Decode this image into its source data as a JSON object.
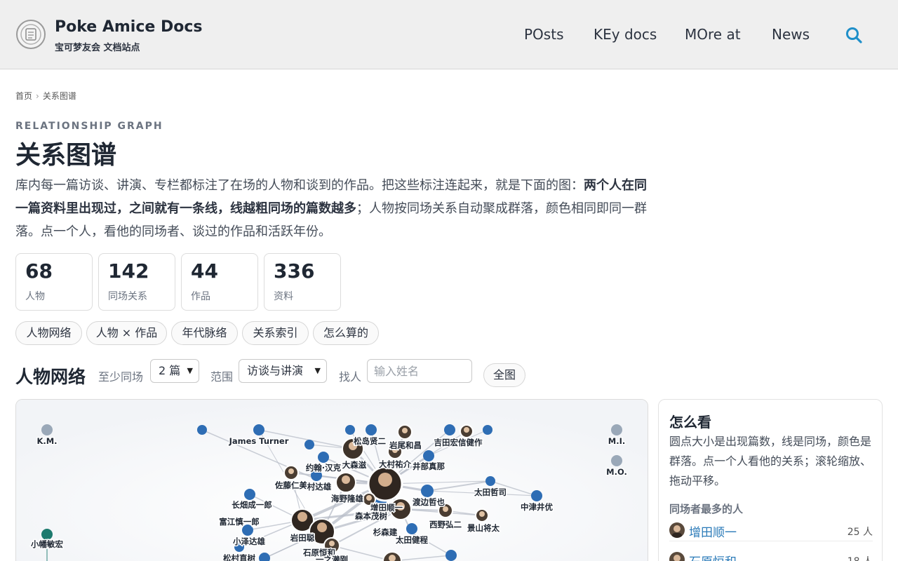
{
  "header": {
    "brand_title": "Poke Amice Docs",
    "brand_subtitle": "宝可梦友会 文档站点",
    "nav": [
      "POsts",
      "KEy docs",
      "MOre at",
      "News"
    ],
    "search_icon": "search-icon",
    "accent_color": "#1f8fc9"
  },
  "breadcrumb": {
    "home": "首页",
    "current": "关系图谱"
  },
  "page": {
    "eyebrow": "RELATIONSHIP GRAPH",
    "title": "关系图谱",
    "intro_1": "库内每一篇访谈、讲演、专栏都标注了在场的人物和谈到的作品。把这些标注连起来，就是下面的图：",
    "intro_bold": "两个人在同一篇资料里出现过，之间就有一条线，线越粗同场的篇数越多",
    "intro_2": "；人物按同场关系自动聚成群落，颜色相同即同一群落。点一个人，看他的同场者、谈过的作品和活跃年份。"
  },
  "stats": [
    {
      "value": "68",
      "label": "人物"
    },
    {
      "value": "142",
      "label": "同场关系"
    },
    {
      "value": "44",
      "label": "作品"
    },
    {
      "value": "336",
      "label": "资料"
    }
  ],
  "tabs": [
    "人物网络",
    "人物 × 作品",
    "年代脉络",
    "关系索引",
    "怎么算的"
  ],
  "controls": {
    "section_title": "人物网络",
    "min_label": "至少同场",
    "min_value": "2 篇",
    "range_label": "范围",
    "range_value": "访谈与讲演",
    "find_label": "找人",
    "find_placeholder": "输入姓名",
    "full_button": "全图"
  },
  "graph": {
    "node_color": "#2e6db4",
    "isolated_color": "#9aa8b8",
    "teal_color": "#1d7a6e",
    "labels": [
      "K.M.",
      "James Turner",
      "松岛贤二",
      "岩尾和昌",
      "吉田宏信健作",
      "M.I.",
      "M.O.",
      "大森滋",
      "大村祐介",
      "井部真那",
      "约翰·汉克",
      "佐藤仁美",
      "村达雄",
      "海野隆雄",
      "太田哲司",
      "中津井优",
      "长畑成一郎",
      "增田顺一",
      "渡边哲也",
      "森本茂树",
      "富江慎一郎",
      "西野弘二",
      "景山将太",
      "杉森建",
      "岩田聪",
      "小泽达雄",
      "太田健程",
      "小幡敏宏",
      "石原恒和",
      "松村直树",
      "一之濑刚"
    ]
  },
  "side": {
    "title": "怎么看",
    "description": "圆点大小是出现篇数，线是同场，颜色是群落。点一个人看他的关系；滚轮缩放、拖动平移。",
    "subhead": "同场者最多的人",
    "people": [
      {
        "name": "增田顺一",
        "count": "25 人"
      },
      {
        "name": "石原恒和",
        "count": "18 人"
      }
    ]
  }
}
